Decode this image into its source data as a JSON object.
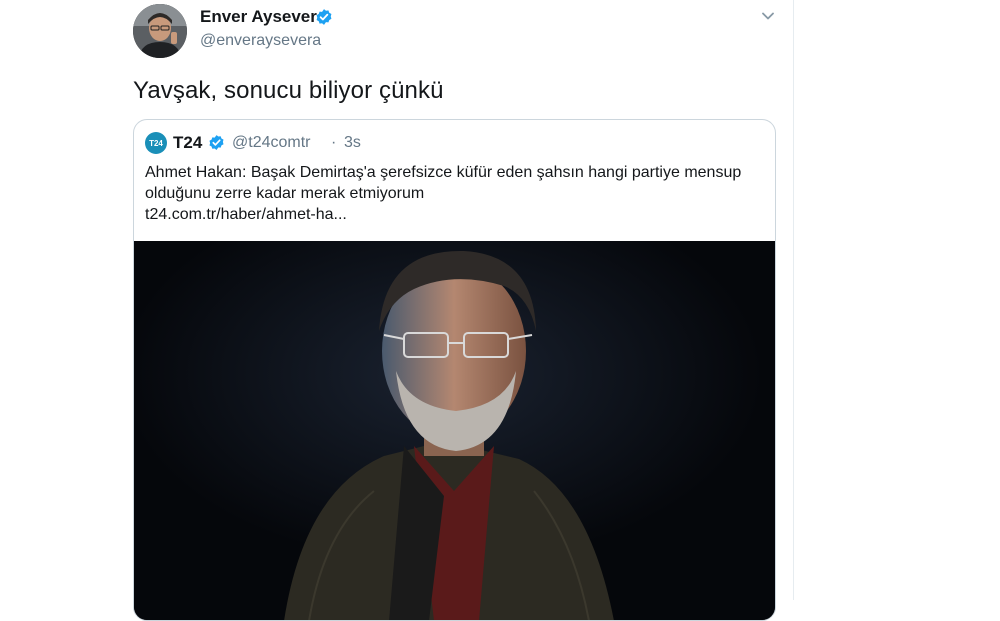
{
  "tweet": {
    "author": {
      "name": "Enver Aysever",
      "handle": "@enveraysevera",
      "verified": true
    },
    "text": "Yavşak, sonucu biliyor çünkü",
    "quoted": {
      "logo_text": "T24",
      "name": "T24",
      "handle": "@t24comtr",
      "separator": "·",
      "time": "3s",
      "text": "Ahmet Hakan: Başak Demirtaş'a şerefsizce küfür eden şahsın hangi partiye mensup olduğunu zerre kadar merak etmiyorum",
      "link": "t24.com.tr/haber/ahmet-ha..."
    }
  },
  "colors": {
    "verified": "#1da1f2",
    "muted": "#657786",
    "border": "#ccd6dd",
    "logo": "#1a8fb8"
  },
  "icons": [
    "verified-icon",
    "chevron-down-icon"
  ]
}
